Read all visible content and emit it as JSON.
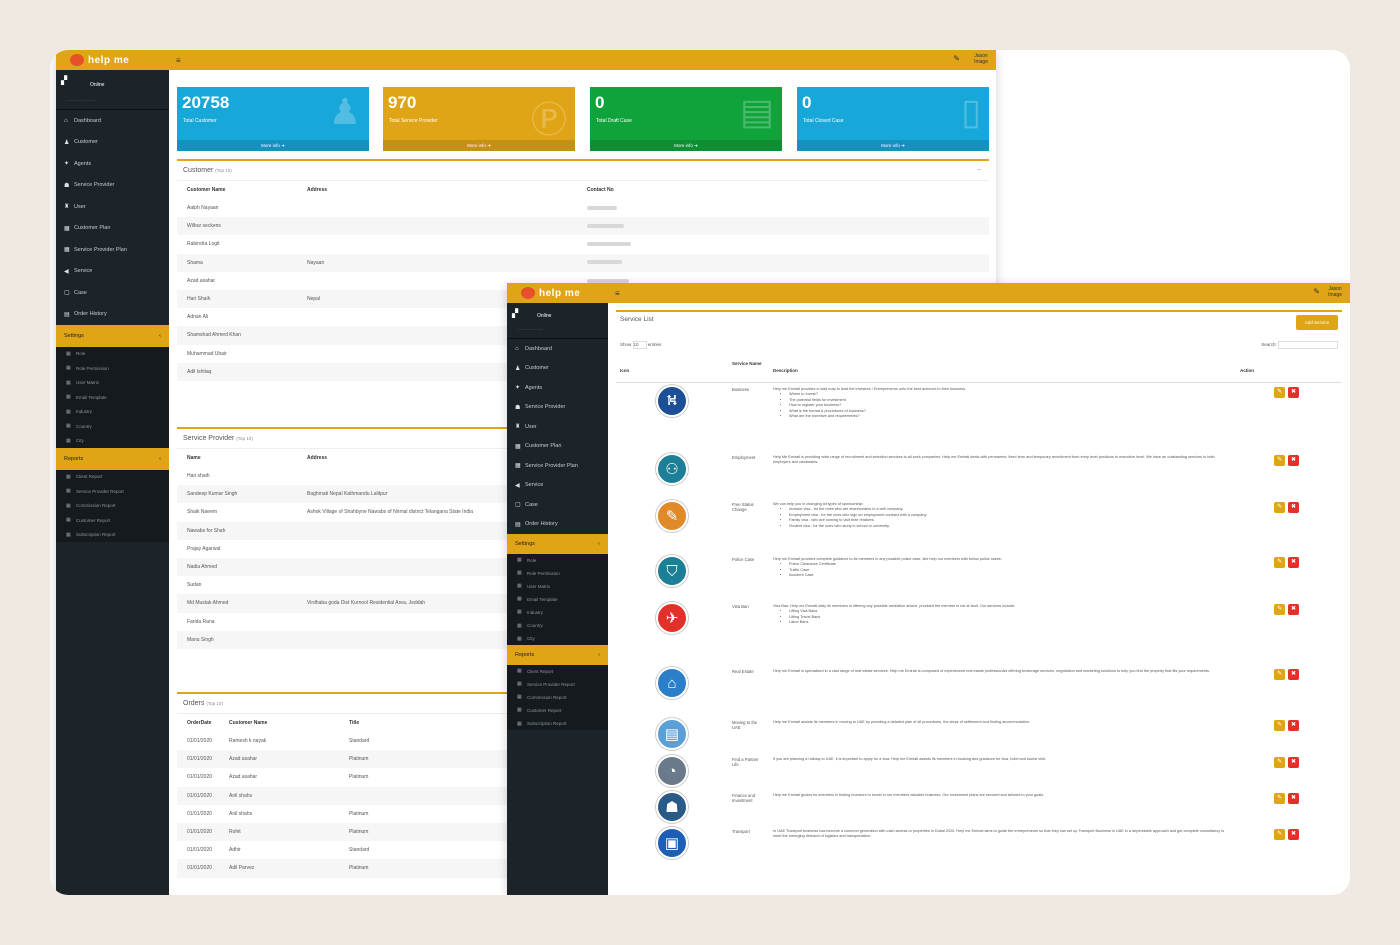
{
  "app": {
    "logo_text": "help me"
  },
  "user_menu": {
    "label": "Jason\nImage"
  },
  "sidebar": {
    "user": {
      "name": "Online",
      "status": ""
    },
    "items": [
      {
        "icon": "dashboard-icon",
        "glyph": "⌂",
        "label": "Dashboard"
      },
      {
        "icon": "customer-icon",
        "glyph": "♟",
        "label": "Customer"
      },
      {
        "icon": "agent-icon",
        "glyph": "✦",
        "label": "Agents"
      },
      {
        "icon": "provider-icon",
        "glyph": "☗",
        "label": "Service Provider"
      },
      {
        "icon": "user-icon",
        "glyph": "♜",
        "label": "User"
      },
      {
        "icon": "plan-icon",
        "glyph": "▦",
        "label": "Customer Plan"
      },
      {
        "icon": "provider-plan-icon",
        "glyph": "▦",
        "label": "Service Provider Plan"
      },
      {
        "icon": "service-icon",
        "glyph": "◀",
        "label": "Service"
      },
      {
        "icon": "case-icon",
        "glyph": "▢",
        "label": "Case"
      },
      {
        "icon": "order-icon",
        "glyph": "▤",
        "label": "Order History"
      }
    ],
    "settings": {
      "label": "Settings",
      "subs": [
        "Role",
        "Role Permission",
        "User Matrix",
        "Email Template",
        "Industry",
        "Country",
        "City"
      ]
    },
    "reports": {
      "label": "Reports",
      "subs": [
        "Client Report",
        "Service Provider Report",
        "Commission Report",
        "Customer Report",
        "Subscription Report"
      ]
    }
  },
  "stats": [
    {
      "value": "20758",
      "label": "Total Customer",
      "more": "More info"
    },
    {
      "value": "970",
      "label": "Total Service Provider",
      "more": "More info"
    },
    {
      "value": "0",
      "label": "Total Draft Case",
      "more": "More info"
    },
    {
      "value": "0",
      "label": "Total Closed Case",
      "more": "More info"
    }
  ],
  "customer_panel": {
    "title": "Customer",
    "subtitle": "(Top 10)",
    "columns": [
      "Customer Name",
      "Address",
      "Contact No"
    ],
    "rows": [
      [
        "Aalph Nayaan",
        "",
        ""
      ],
      [
        "Wilbur seckens",
        "",
        ""
      ],
      [
        "Rabindra Logit",
        "",
        ""
      ],
      [
        "Shama",
        "Nayaan",
        ""
      ],
      [
        "Azad asahar",
        "",
        ""
      ],
      [
        "Hari Shaih",
        "Nepal",
        ""
      ],
      [
        "Adnan Ali",
        "",
        ""
      ],
      [
        "Shamshad Ahmed Khan",
        "",
        ""
      ],
      [
        "Muhammad Ubair",
        "",
        ""
      ],
      [
        "Adil Ishtiaq",
        "",
        ""
      ]
    ]
  },
  "provider_panel": {
    "title": "Service Provider",
    "subtitle": "(Top 10)",
    "columns": [
      "Name",
      "Address"
    ],
    "rows": [
      [
        "Hari shaih",
        ""
      ],
      [
        "Sandeep Kumar Singh",
        "Baghmati Nepal Kathmandu Lalitpur"
      ],
      [
        "Shaik Naeem",
        "Ashok Village of Shahbyne Nawabs of Nirmal district Telangana State India"
      ],
      [
        "Nawabs for Shah",
        ""
      ],
      [
        "Prajay Agarwal",
        ""
      ],
      [
        "Nadia Ahmed",
        ""
      ],
      [
        "Sudan",
        ""
      ],
      [
        "Md Mustak Ahmed",
        "Virdhaba goda Dist Kurnool Residential Area, Jeddah"
      ],
      [
        "Farida Rana",
        ""
      ],
      [
        "Manu Singh",
        ""
      ]
    ]
  },
  "orders_panel": {
    "title": "Orders",
    "subtitle": "(Top 10)",
    "columns": [
      "OrderDate",
      "Customer Name",
      "Title"
    ],
    "rows": [
      [
        "01/01/2020",
        "Ramesh k nayak",
        "Standard"
      ],
      [
        "01/01/2020",
        "Azad asahar",
        "Platinum"
      ],
      [
        "01/01/2020",
        "Azad asahar",
        "Platinum"
      ],
      [
        "01/01/2020",
        "Anil shahs",
        ""
      ],
      [
        "01/01/2020",
        "Anil shahs",
        "Platinum"
      ],
      [
        "01/01/2020",
        "Rohit",
        "Platinum"
      ],
      [
        "01/01/2020",
        "Adhir",
        "Standard"
      ],
      [
        "01/01/2020",
        "Adil Parvez",
        "Platinum"
      ]
    ]
  },
  "service_list": {
    "title": "Service List",
    "add_label": "Add Service",
    "show_label": "Show",
    "entries_value": "10",
    "entries_label": "entries",
    "search_label": "Search:",
    "columns": [
      "Icon",
      "Service Name",
      "Description",
      "Action"
    ],
    "rows": [
      {
        "icon": "business-icon",
        "glyph": "⛕",
        "color": "#1d4f96",
        "name": "Business",
        "desc": "Help me Emirati provides a road map to lead the investors / Entrepreneurs onto the best avenues to their business.",
        "bullets": [
          "Where to Invest?",
          "The potential fields for investment",
          "How to register your business?",
          "What is the format & procedures of business?",
          "What are the incentive and requirements?"
        ]
      },
      {
        "icon": "employment-icon",
        "glyph": "⚇",
        "color": "#1d7f96",
        "name": "Employment",
        "desc": "Help Me Emirati is providing wide range of recruitment and selection services to all work companies. Help me Emirati deals with permanent, fixed term and temporary recruitment from entry level positions to executive level. We have an outstanding services to both employers and candidates.",
        "bullets": []
      },
      {
        "icon": "free-status-icon",
        "glyph": "✎",
        "color": "#e08a2a",
        "name": "Free Status Change",
        "desc": "We can help you in changing all types of sponsorship:",
        "bullets": [
          "Investor visa - for the ones who are shareholders in a well company.",
          "Employment visa - for the ones who sign an employment contract with a company.",
          "Family visa - who are coming to visit their relatives.",
          "Student visa - for the ones who study in school or university."
        ]
      },
      {
        "icon": "police-icon",
        "glyph": "⛉",
        "color": "#1d7f96",
        "name": "Police Case",
        "desc": "Help me Emirati provides complete guidance to its members in any possible police case, like help our members with below police cases:",
        "bullets": [
          "Police Clearance Certificate",
          "Traffic Case",
          "Accident Case"
        ]
      },
      {
        "icon": "visa-ban-icon",
        "glyph": "✈",
        "color": "#e2312a",
        "name": "Visa Ban",
        "desc": "Visa Ban: Help me Emirati daily its members in offering any possible mediation advice, provided the member is not at fault. Our services include:",
        "bullets": [
          "Lifting Visa Bans",
          "Lifting Travel Bans",
          "Labor Bans"
        ]
      },
      {
        "icon": "real-estate-icon",
        "glyph": "⌂",
        "color": "#2a7fc8",
        "name": "Real Estate",
        "desc": "Help me Emirati is specialized in a vast range of real estate services. Help me Emirati is composed of experienced real estate professionals offering brokerage services, negotiation and marketing solutions to help you find the property that fits your requirements.",
        "bullets": []
      },
      {
        "icon": "moving-icon",
        "glyph": "▤",
        "color": "#5aa0d8",
        "name": "Moving to the UAE",
        "desc": "Help me Emirati assists its members in moving to UAE by providing a detailed plan of all procedures, the steps of settlement and finding accommodation.",
        "bullets": []
      },
      {
        "icon": "life-partner-icon",
        "glyph": "◔",
        "color": "#6a7a8a",
        "name": "Find a Partner Life",
        "desc": "If you are planning a holiday to UAE, it is important to apply for a visa. Help me Emirati assists its members in booking and guidance for visa, hotel and tourist visit.",
        "bullets": []
      },
      {
        "icon": "finance-icon",
        "glyph": "☗",
        "color": "#2a5a86",
        "name": "Finance and Investment",
        "desc": "Help me Emirati guides its members in finding investors to invest in our members valuable business. Our investment plans are secured and tailored to your goals.",
        "bullets": []
      },
      {
        "icon": "transport-icon",
        "glyph": "▣",
        "color": "#1d5fb6",
        "name": "Transport",
        "desc": "In UAE Transport business has become a common generation with cash access or properties in Dubai 2020. Help me Emirati aims to guide the entrepreneurs so that they can set up Transport Business in UAE in a dependable approach and get complete consultancy to meet the emerging demand of logistics and transportation.",
        "bullets": []
      }
    ]
  },
  "colors": {
    "accent": "#e0a517",
    "sidebar": "#1c2429",
    "blue": "#17a7d8",
    "green": "#10a33b",
    "danger": "#e2312a"
  }
}
